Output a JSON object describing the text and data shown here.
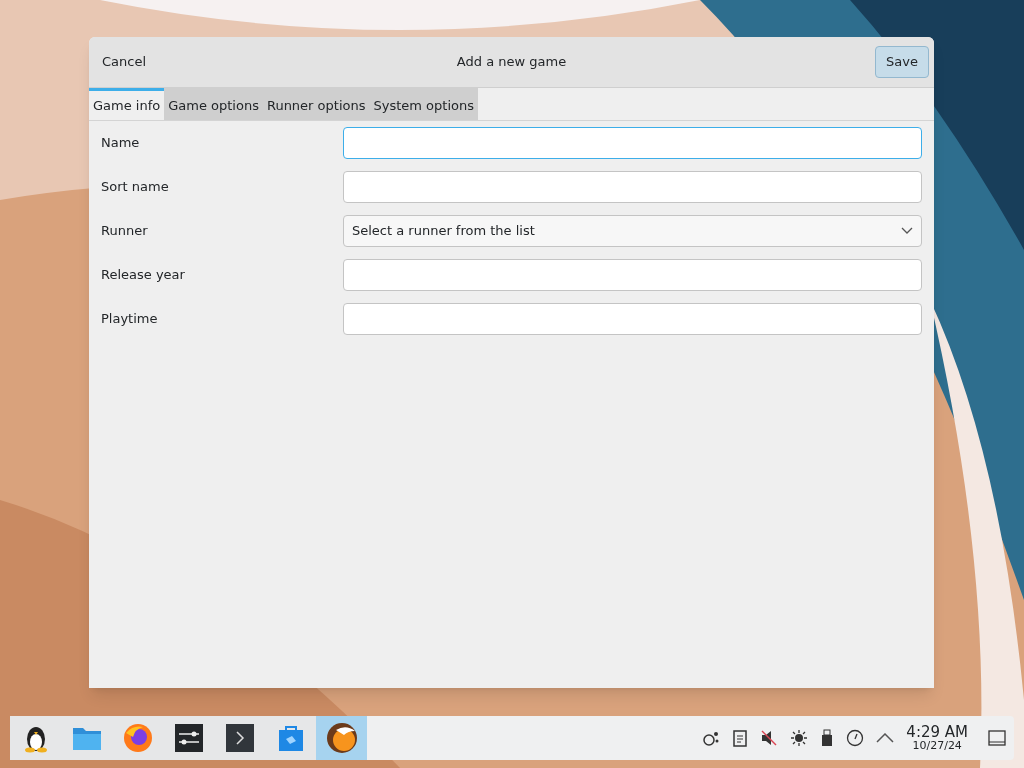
{
  "dialog": {
    "title": "Add a new game",
    "cancel": "Cancel",
    "save": "Save"
  },
  "tabs": [
    {
      "label": "Game info",
      "selected": true
    },
    {
      "label": "Game options",
      "selected": false
    },
    {
      "label": "Runner options",
      "selected": false
    },
    {
      "label": "System options",
      "selected": false
    }
  ],
  "fields": [
    {
      "label": "Name",
      "kind": "text",
      "focused": true
    },
    {
      "label": "Sort name",
      "kind": "text",
      "focused": false
    },
    {
      "label": "Runner",
      "kind": "select",
      "value": "Select a runner from the list",
      "focused": false
    },
    {
      "label": "Release year",
      "kind": "text",
      "focused": false
    },
    {
      "label": "Playtime",
      "kind": "text",
      "focused": false
    }
  ],
  "taskbar": {
    "apps": [
      {
        "kind": "penguin",
        "selected": false
      },
      {
        "kind": "folder",
        "selected": false
      },
      {
        "kind": "browser",
        "selected": false
      },
      {
        "kind": "sliders",
        "selected": false
      },
      {
        "kind": "terminal",
        "selected": false
      },
      {
        "kind": "store",
        "selected": false
      },
      {
        "kind": "game",
        "selected": true
      }
    ],
    "clock": {
      "time": "4:29 AM",
      "date": "10/27/24"
    }
  }
}
